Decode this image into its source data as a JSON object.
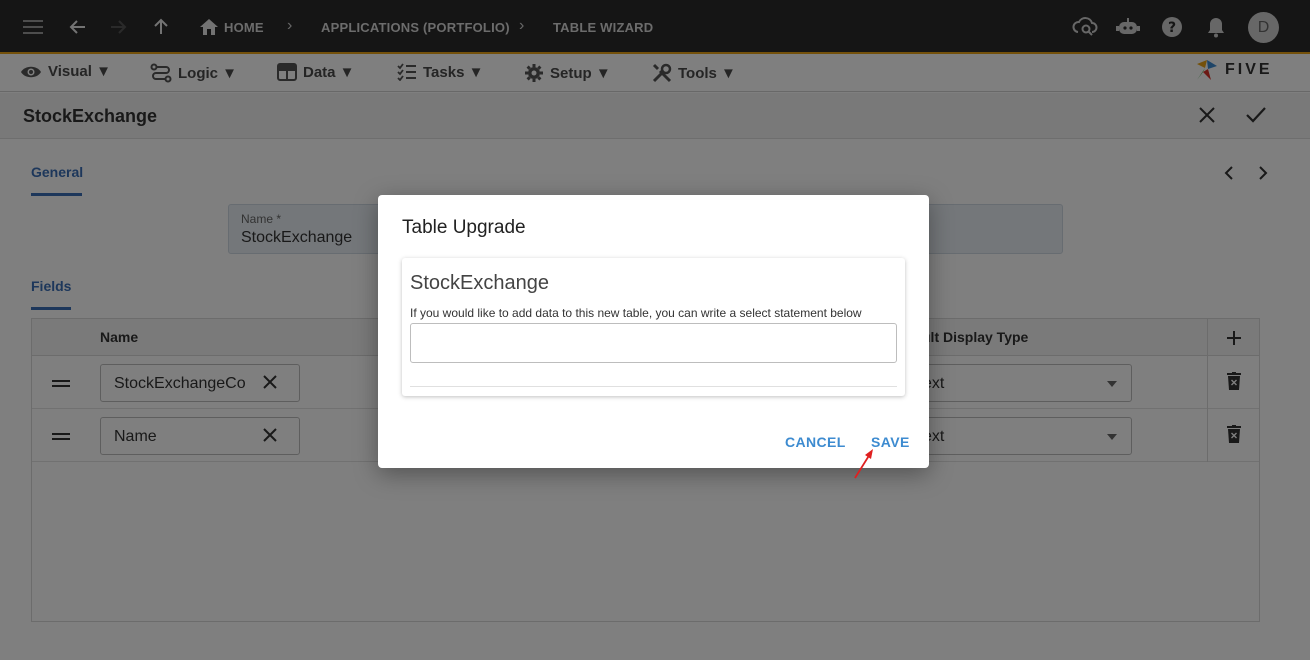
{
  "topbar": {
    "breadcrumbs": [
      "HOME",
      "APPLICATIONS (PORTFOLIO)",
      "TABLE WIZARD"
    ],
    "avatar_initial": "D"
  },
  "menu": {
    "items": [
      {
        "label": "Visual ▼",
        "icon": "eye-icon"
      },
      {
        "label": "Logic ▼",
        "icon": "logic-icon"
      },
      {
        "label": "Data ▼",
        "icon": "table-icon"
      },
      {
        "label": "Tasks ▼",
        "icon": "tasks-icon"
      },
      {
        "label": "Setup ▼",
        "icon": "gear-icon"
      },
      {
        "label": "Tools ▼",
        "icon": "tools-icon"
      }
    ],
    "logo_text": "FIVE"
  },
  "page": {
    "title": "StockExchange"
  },
  "form": {
    "general_tab": "General",
    "name_label": "Name *",
    "name_value": "StockExchange",
    "fields_tab": "Fields"
  },
  "grid": {
    "columns": {
      "name": "Name",
      "display_type": "ult Display Type"
    },
    "rows": [
      {
        "name": "StockExchangeCo",
        "display_type": "ext"
      },
      {
        "name": "Name",
        "display_type": "ext"
      }
    ]
  },
  "dialog": {
    "title": "Table Upgrade",
    "card_title": "StockExchange",
    "help_text": "If you would like to add data to this new table, you can write a select statement below",
    "sql_value": "",
    "cancel_label": "CANCEL",
    "save_label": "SAVE"
  },
  "colors": {
    "accent": "#3b6fb6",
    "topbar": "#2b2b2b",
    "topbar_border": "#e8a317",
    "dialog_button": "#3d8bd0",
    "annotation_arrow": "#e02020"
  }
}
